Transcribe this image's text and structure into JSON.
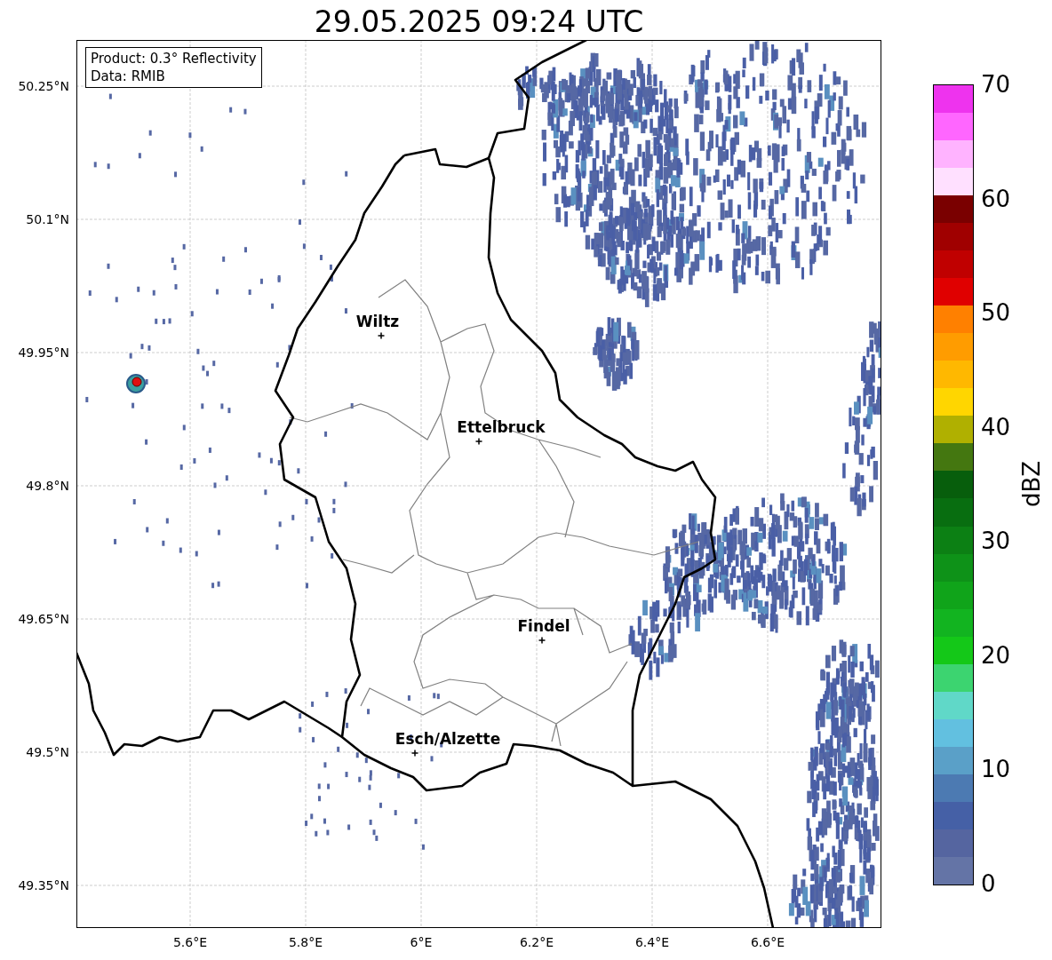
{
  "title": "29.05.2025 09:24 UTC",
  "info_box": {
    "product": "Product: 0.3° Reflectivity",
    "data": "Data: RMIB"
  },
  "map": {
    "y_ticks": [
      "50.25°N",
      "50.1°N",
      "49.95°N",
      "49.8°N",
      "49.65°N",
      "49.5°N",
      "49.35°N"
    ],
    "x_ticks": [
      "5.6°E",
      "5.8°E",
      "6°E",
      "6.2°E",
      "6.4°E",
      "6.6°E"
    ],
    "cities": [
      {
        "name": "Wiltz"
      },
      {
        "name": "Ettelbruck"
      },
      {
        "name": "Findel"
      },
      {
        "name": "Esch/Alzette"
      }
    ]
  },
  "colorbar": {
    "label": "dBZ",
    "ticks": [
      "70",
      "60",
      "50",
      "40",
      "30",
      "20",
      "10",
      "0"
    ]
  }
}
